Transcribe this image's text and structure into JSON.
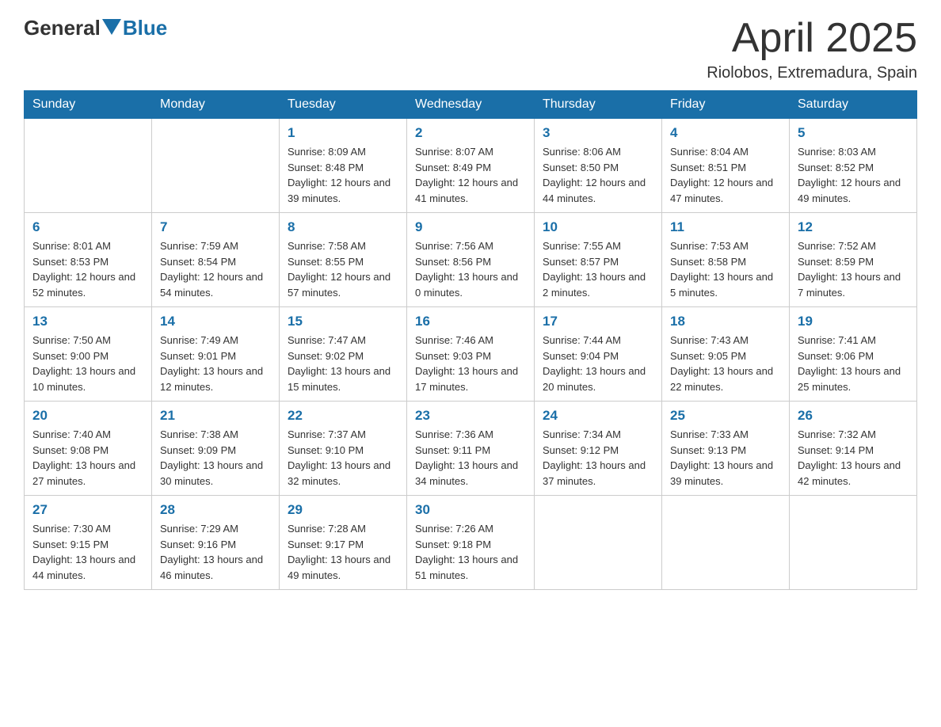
{
  "header": {
    "logo_general": "General",
    "logo_blue": "Blue",
    "title": "April 2025",
    "subtitle": "Riolobos, Extremadura, Spain"
  },
  "weekdays": [
    "Sunday",
    "Monday",
    "Tuesday",
    "Wednesday",
    "Thursday",
    "Friday",
    "Saturday"
  ],
  "weeks": [
    [
      {
        "day": "",
        "sunrise": "",
        "sunset": "",
        "daylight": ""
      },
      {
        "day": "",
        "sunrise": "",
        "sunset": "",
        "daylight": ""
      },
      {
        "day": "1",
        "sunrise": "Sunrise: 8:09 AM",
        "sunset": "Sunset: 8:48 PM",
        "daylight": "Daylight: 12 hours and 39 minutes."
      },
      {
        "day": "2",
        "sunrise": "Sunrise: 8:07 AM",
        "sunset": "Sunset: 8:49 PM",
        "daylight": "Daylight: 12 hours and 41 minutes."
      },
      {
        "day": "3",
        "sunrise": "Sunrise: 8:06 AM",
        "sunset": "Sunset: 8:50 PM",
        "daylight": "Daylight: 12 hours and 44 minutes."
      },
      {
        "day": "4",
        "sunrise": "Sunrise: 8:04 AM",
        "sunset": "Sunset: 8:51 PM",
        "daylight": "Daylight: 12 hours and 47 minutes."
      },
      {
        "day": "5",
        "sunrise": "Sunrise: 8:03 AM",
        "sunset": "Sunset: 8:52 PM",
        "daylight": "Daylight: 12 hours and 49 minutes."
      }
    ],
    [
      {
        "day": "6",
        "sunrise": "Sunrise: 8:01 AM",
        "sunset": "Sunset: 8:53 PM",
        "daylight": "Daylight: 12 hours and 52 minutes."
      },
      {
        "day": "7",
        "sunrise": "Sunrise: 7:59 AM",
        "sunset": "Sunset: 8:54 PM",
        "daylight": "Daylight: 12 hours and 54 minutes."
      },
      {
        "day": "8",
        "sunrise": "Sunrise: 7:58 AM",
        "sunset": "Sunset: 8:55 PM",
        "daylight": "Daylight: 12 hours and 57 minutes."
      },
      {
        "day": "9",
        "sunrise": "Sunrise: 7:56 AM",
        "sunset": "Sunset: 8:56 PM",
        "daylight": "Daylight: 13 hours and 0 minutes."
      },
      {
        "day": "10",
        "sunrise": "Sunrise: 7:55 AM",
        "sunset": "Sunset: 8:57 PM",
        "daylight": "Daylight: 13 hours and 2 minutes."
      },
      {
        "day": "11",
        "sunrise": "Sunrise: 7:53 AM",
        "sunset": "Sunset: 8:58 PM",
        "daylight": "Daylight: 13 hours and 5 minutes."
      },
      {
        "day": "12",
        "sunrise": "Sunrise: 7:52 AM",
        "sunset": "Sunset: 8:59 PM",
        "daylight": "Daylight: 13 hours and 7 minutes."
      }
    ],
    [
      {
        "day": "13",
        "sunrise": "Sunrise: 7:50 AM",
        "sunset": "Sunset: 9:00 PM",
        "daylight": "Daylight: 13 hours and 10 minutes."
      },
      {
        "day": "14",
        "sunrise": "Sunrise: 7:49 AM",
        "sunset": "Sunset: 9:01 PM",
        "daylight": "Daylight: 13 hours and 12 minutes."
      },
      {
        "day": "15",
        "sunrise": "Sunrise: 7:47 AM",
        "sunset": "Sunset: 9:02 PM",
        "daylight": "Daylight: 13 hours and 15 minutes."
      },
      {
        "day": "16",
        "sunrise": "Sunrise: 7:46 AM",
        "sunset": "Sunset: 9:03 PM",
        "daylight": "Daylight: 13 hours and 17 minutes."
      },
      {
        "day": "17",
        "sunrise": "Sunrise: 7:44 AM",
        "sunset": "Sunset: 9:04 PM",
        "daylight": "Daylight: 13 hours and 20 minutes."
      },
      {
        "day": "18",
        "sunrise": "Sunrise: 7:43 AM",
        "sunset": "Sunset: 9:05 PM",
        "daylight": "Daylight: 13 hours and 22 minutes."
      },
      {
        "day": "19",
        "sunrise": "Sunrise: 7:41 AM",
        "sunset": "Sunset: 9:06 PM",
        "daylight": "Daylight: 13 hours and 25 minutes."
      }
    ],
    [
      {
        "day": "20",
        "sunrise": "Sunrise: 7:40 AM",
        "sunset": "Sunset: 9:08 PM",
        "daylight": "Daylight: 13 hours and 27 minutes."
      },
      {
        "day": "21",
        "sunrise": "Sunrise: 7:38 AM",
        "sunset": "Sunset: 9:09 PM",
        "daylight": "Daylight: 13 hours and 30 minutes."
      },
      {
        "day": "22",
        "sunrise": "Sunrise: 7:37 AM",
        "sunset": "Sunset: 9:10 PM",
        "daylight": "Daylight: 13 hours and 32 minutes."
      },
      {
        "day": "23",
        "sunrise": "Sunrise: 7:36 AM",
        "sunset": "Sunset: 9:11 PM",
        "daylight": "Daylight: 13 hours and 34 minutes."
      },
      {
        "day": "24",
        "sunrise": "Sunrise: 7:34 AM",
        "sunset": "Sunset: 9:12 PM",
        "daylight": "Daylight: 13 hours and 37 minutes."
      },
      {
        "day": "25",
        "sunrise": "Sunrise: 7:33 AM",
        "sunset": "Sunset: 9:13 PM",
        "daylight": "Daylight: 13 hours and 39 minutes."
      },
      {
        "day": "26",
        "sunrise": "Sunrise: 7:32 AM",
        "sunset": "Sunset: 9:14 PM",
        "daylight": "Daylight: 13 hours and 42 minutes."
      }
    ],
    [
      {
        "day": "27",
        "sunrise": "Sunrise: 7:30 AM",
        "sunset": "Sunset: 9:15 PM",
        "daylight": "Daylight: 13 hours and 44 minutes."
      },
      {
        "day": "28",
        "sunrise": "Sunrise: 7:29 AM",
        "sunset": "Sunset: 9:16 PM",
        "daylight": "Daylight: 13 hours and 46 minutes."
      },
      {
        "day": "29",
        "sunrise": "Sunrise: 7:28 AM",
        "sunset": "Sunset: 9:17 PM",
        "daylight": "Daylight: 13 hours and 49 minutes."
      },
      {
        "day": "30",
        "sunrise": "Sunrise: 7:26 AM",
        "sunset": "Sunset: 9:18 PM",
        "daylight": "Daylight: 13 hours and 51 minutes."
      },
      {
        "day": "",
        "sunrise": "",
        "sunset": "",
        "daylight": ""
      },
      {
        "day": "",
        "sunrise": "",
        "sunset": "",
        "daylight": ""
      },
      {
        "day": "",
        "sunrise": "",
        "sunset": "",
        "daylight": ""
      }
    ]
  ]
}
